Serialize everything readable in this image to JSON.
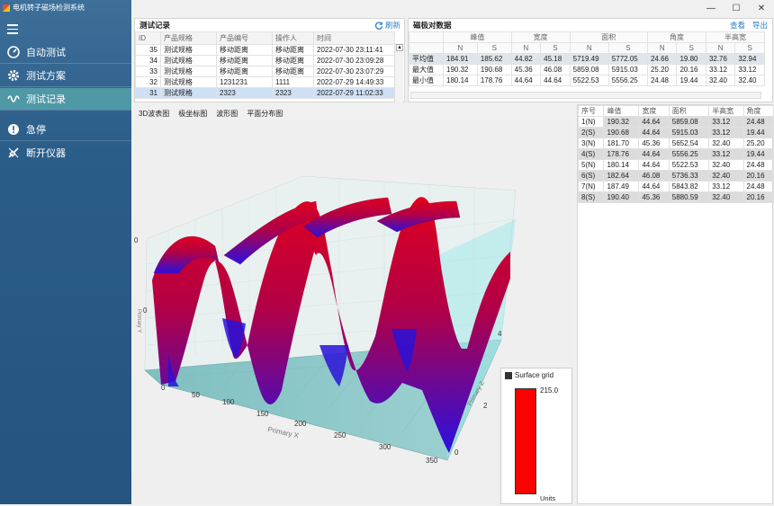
{
  "app": {
    "title": "电机转子磁场检测系统"
  },
  "window": {
    "minimize": "—",
    "maximize": "☐",
    "close": "✕"
  },
  "sidebar": {
    "items": [
      {
        "label": "自动测试",
        "icon": "speedometer-icon"
      },
      {
        "label": "测试方案",
        "icon": "gear-icon"
      },
      {
        "label": "测试记录",
        "icon": "wave-icon"
      },
      {
        "label": "急停",
        "icon": "alert-icon"
      },
      {
        "label": "断开仪器",
        "icon": "disconnect-icon"
      }
    ]
  },
  "records": {
    "title": "测试记录",
    "refresh": "刷新",
    "columns": [
      "ID",
      "产品规格",
      "产品编号",
      "操作人",
      "时间"
    ],
    "rows": [
      [
        "35",
        "测试规格",
        "移动距离",
        "移动距离",
        "2022-07-30 23:11:41"
      ],
      [
        "34",
        "测试规格",
        "移动距离",
        "移动距离",
        "2022-07-30 23:09:28"
      ],
      [
        "33",
        "测试规格",
        "移动距离",
        "移动距离",
        "2022-07-30 23:07:29"
      ],
      [
        "32",
        "测试规格",
        "1231231",
        "1111",
        "2022-07-29 14:49:33"
      ],
      [
        "31",
        "测试规格",
        "2323",
        "2323",
        "2022-07-29 11:02:33"
      ]
    ]
  },
  "extremes": {
    "title": "磁极对数据",
    "view": "查看",
    "export": "导出",
    "groups": [
      "峰值",
      "宽度",
      "面积",
      "角度",
      "半高宽"
    ],
    "subcols": [
      "N",
      "S",
      "N",
      "S",
      "N",
      "S",
      "N",
      "S",
      "N",
      "S"
    ],
    "rows": [
      {
        "label": "平均值",
        "values": [
          "184.91",
          "185.62",
          "44.82",
          "45.18",
          "5719.49",
          "5772.05",
          "24.66",
          "19.80",
          "32.76",
          "32.94"
        ]
      },
      {
        "label": "最大值",
        "values": [
          "190.32",
          "190.68",
          "45.36",
          "46.08",
          "5859.08",
          "5915.03",
          "25.20",
          "20.16",
          "33.12",
          "33.12"
        ]
      },
      {
        "label": "最小值",
        "values": [
          "180.14",
          "178.76",
          "44.64",
          "44.64",
          "5522.53",
          "5556.25",
          "24.48",
          "19.44",
          "32.40",
          "32.40"
        ]
      }
    ]
  },
  "tabs": [
    "3D波表图",
    "极坐标图",
    "波形图",
    "平面分布图"
  ],
  "chart": {
    "x_axis_label": "Primary X",
    "z_axis_label": "Primary Z",
    "y_axis_label": "Primary Y",
    "x_ticks": [
      "0",
      "50",
      "100",
      "150",
      "200",
      "250",
      "300",
      "350"
    ],
    "z_ticks": [
      "0",
      "2",
      "4"
    ],
    "y_ticks": [
      "0",
      "0"
    ],
    "legend_title": "Surface grid",
    "legend_max": "215.0",
    "legend_unit": "Units",
    "legend_color": "#ff0000"
  },
  "poles": {
    "columns": [
      "序号",
      "峰值",
      "宽度",
      "面积",
      "半高宽",
      "角度"
    ],
    "rows": [
      [
        "1(N)",
        "190.32",
        "44.64",
        "5859.08",
        "33.12",
        "24.48"
      ],
      [
        "2(S)",
        "190.68",
        "44.64",
        "5915.03",
        "33.12",
        "19.44"
      ],
      [
        "3(N)",
        "181.70",
        "45.36",
        "5652.54",
        "32.40",
        "25.20"
      ],
      [
        "4(S)",
        "178.76",
        "44.64",
        "5556.25",
        "33.12",
        "19.44"
      ],
      [
        "5(N)",
        "180.14",
        "44.64",
        "5522.53",
        "32.40",
        "24.48"
      ],
      [
        "6(S)",
        "182.64",
        "46.08",
        "5736.33",
        "32.40",
        "20.16"
      ],
      [
        "7(N)",
        "187.49",
        "44.64",
        "5843.82",
        "33.12",
        "24.48"
      ],
      [
        "8(S)",
        "190.40",
        "45.36",
        "5880.59",
        "32.40",
        "20.16"
      ]
    ]
  }
}
